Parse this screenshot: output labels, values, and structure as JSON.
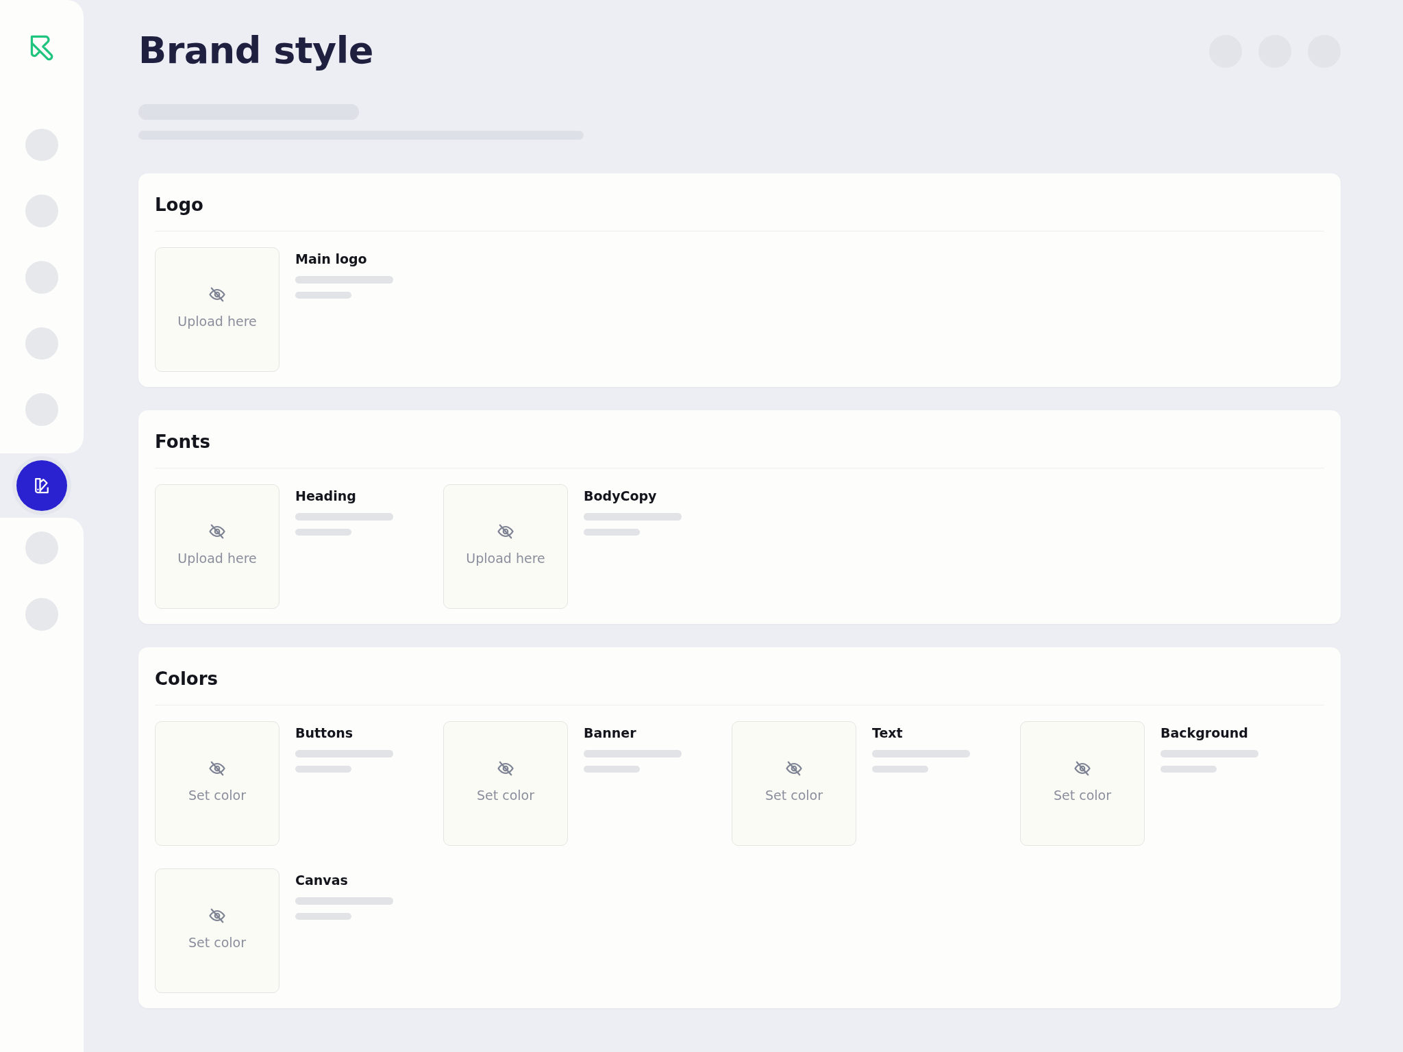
{
  "sidebar": {
    "items": [
      {
        "selected": false
      },
      {
        "selected": false
      },
      {
        "selected": false
      },
      {
        "selected": false
      },
      {
        "selected": false
      },
      {
        "selected": true
      },
      {
        "selected": false
      },
      {
        "selected": false
      }
    ]
  },
  "page": {
    "title": "Brand style"
  },
  "sections": [
    {
      "title": "Logo",
      "items": [
        {
          "label": "Main logo",
          "action": "Upload here"
        }
      ]
    },
    {
      "title": "Fonts",
      "items": [
        {
          "label": "Heading",
          "action": "Upload here"
        },
        {
          "label": "BodyCopy",
          "action": "Upload here"
        }
      ]
    },
    {
      "title": "Colors",
      "items": [
        {
          "label": "Buttons",
          "action": "Set color"
        },
        {
          "label": "Banner",
          "action": "Set color"
        },
        {
          "label": "Text",
          "action": "Set color"
        },
        {
          "label": "Background",
          "action": "Set color"
        },
        {
          "label": "Canvas",
          "action": "Set color"
        }
      ]
    }
  ]
}
